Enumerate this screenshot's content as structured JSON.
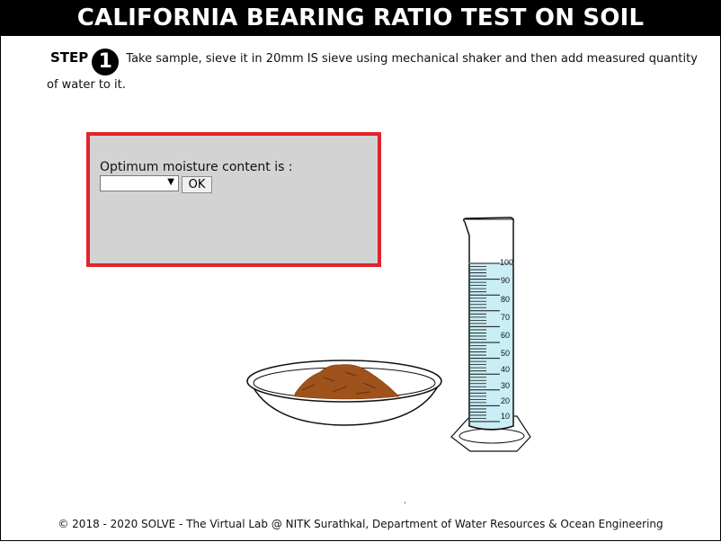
{
  "header": {
    "title": "CALIFORNIA BEARING RATIO TEST ON SOIL"
  },
  "step": {
    "label": "STEP",
    "number": "1",
    "instruction": "Take sample, sieve it in 20mm IS sieve using mechanical shaker and then add measured quantity of water to it."
  },
  "dialog": {
    "label": "Optimum moisture content is :",
    "selected_value": "",
    "ok_label": "OK",
    "border_color": "#e3232b",
    "background_color": "#d3d3d3"
  },
  "cylinder": {
    "scale_labels": [
      "100",
      "90",
      "80",
      "70",
      "60",
      "50",
      "40",
      "30",
      "20",
      "10"
    ],
    "liquid_color": "#c9eef5"
  },
  "bowl": {
    "soil_color": "#a0521c"
  },
  "dot": ".",
  "footer": {
    "text": "© 2018 - 2020 SOLVE - The Virtual Lab @ NITK Surathkal, Department of Water Resources & Ocean Engineering"
  }
}
